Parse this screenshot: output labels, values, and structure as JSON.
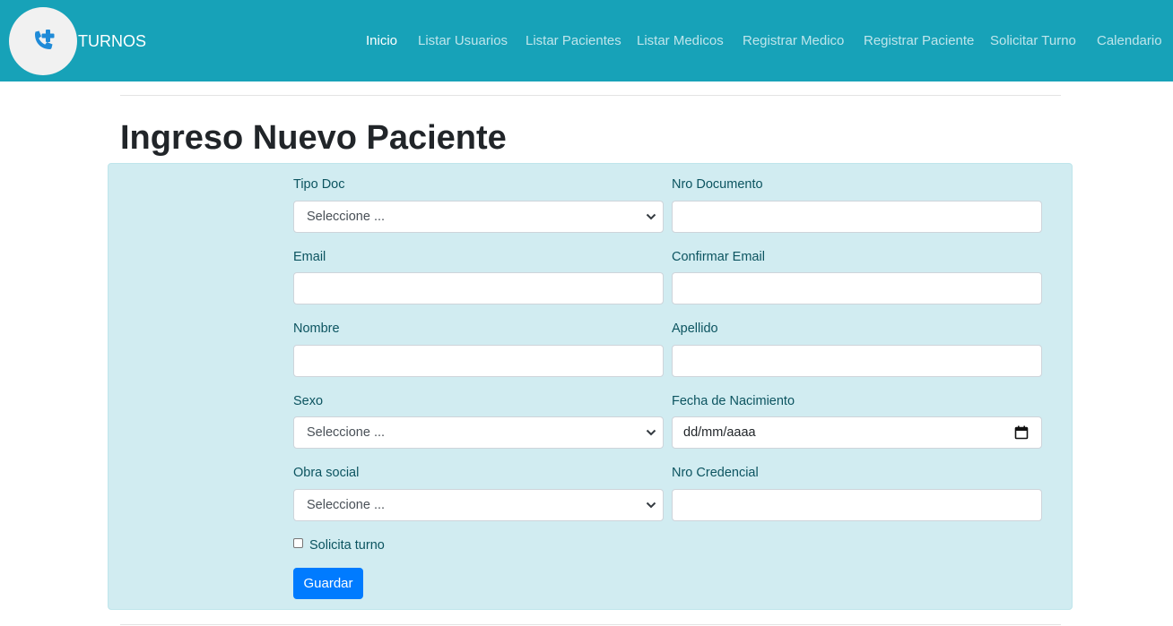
{
  "navbar": {
    "brand": "TURNOS",
    "logo_icon": "phone-medical-icon",
    "items": [
      {
        "label": "Inicio",
        "active": true
      },
      {
        "label": "Listar Usuarios",
        "active": false
      },
      {
        "label": "Listar Pacientes",
        "active": false
      },
      {
        "label": "Listar Medicos",
        "active": false
      },
      {
        "label": "Registrar Medico",
        "active": false
      },
      {
        "label": "Registrar Paciente",
        "active": false
      },
      {
        "label": "Solicitar Turno",
        "active": false
      },
      {
        "label": "Calendario",
        "active": false
      }
    ]
  },
  "page": {
    "title": "Ingreso Nuevo Paciente"
  },
  "form": {
    "tipo_doc": {
      "label": "Tipo Doc",
      "value": "Seleccione ..."
    },
    "nro_documento": {
      "label": "Nro Documento",
      "value": "",
      "placeholder": ""
    },
    "email": {
      "label": "Email",
      "value": "",
      "placeholder": ""
    },
    "confirmar_email": {
      "label": "Confirmar Email",
      "value": "",
      "placeholder": ""
    },
    "nombre": {
      "label": "Nombre",
      "value": "",
      "placeholder": ""
    },
    "apellido": {
      "label": "Apellido",
      "value": "",
      "placeholder": ""
    },
    "sexo": {
      "label": "Sexo",
      "value": "Seleccione ..."
    },
    "fecha_nacimiento": {
      "label": "Fecha de Nacimiento",
      "value": "dd/mm/aaaa"
    },
    "obra_social": {
      "label": "Obra social",
      "value": "Seleccione ..."
    },
    "nro_credencial": {
      "label": "Nro Credencial",
      "value": "",
      "placeholder": ""
    },
    "solicita_turno": {
      "label": "Solicita turno",
      "checked": false
    },
    "submit_label": "Guardar"
  },
  "colors": {
    "navbar_bg": "#17a2b8",
    "panel_bg": "#d1ecf1",
    "panel_text": "#0c5460",
    "primary_button": "#007bff"
  }
}
